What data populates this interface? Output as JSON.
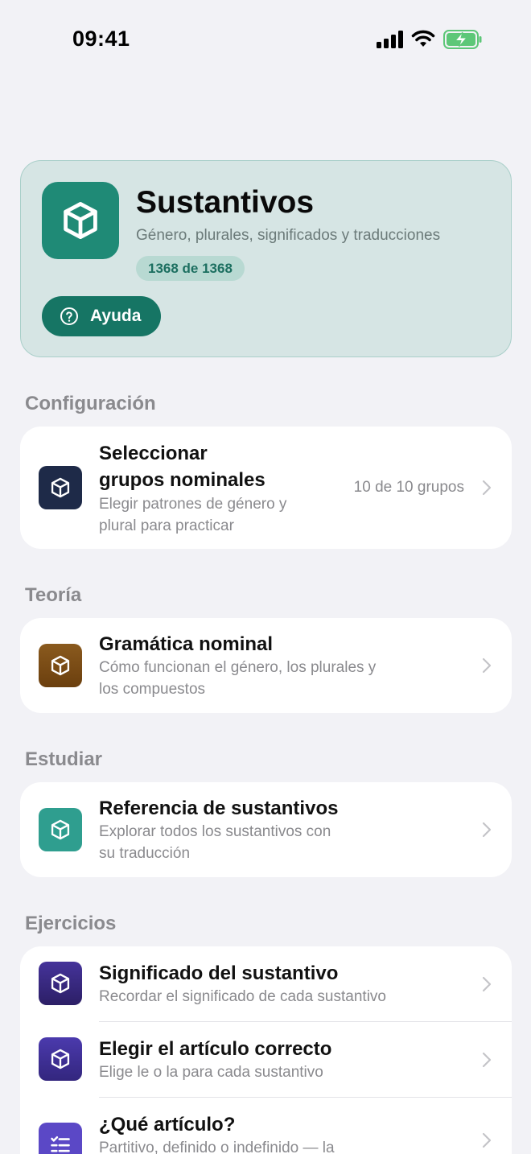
{
  "status_bar": {
    "time": "09:41"
  },
  "hero": {
    "title": "Sustantivos",
    "subtitle": "Género, plurales, significados y traducciones",
    "badge": "1368 de 1368",
    "help_label": "Ayuda",
    "icon": "cube-icon",
    "accent": "#1f8a76"
  },
  "sections": {
    "config": {
      "title": "Configuración",
      "item": {
        "title_line1": "Seleccionar",
        "title_line2": "grupos nominales",
        "desc_line1": "Elegir patrones de género y",
        "desc_line2": "plural para practicar",
        "value": "10 de 10 grupos",
        "icon_color": "#1e2a48"
      }
    },
    "theory": {
      "title": "Teoría",
      "item": {
        "title": "Gramática nominal",
        "desc_line1": "Cómo funcionan el género, los plurales y",
        "desc_line2": "los compuestos",
        "icon_color": "#7a4a14"
      }
    },
    "study": {
      "title": "Estudiar",
      "item": {
        "title": "Referencia de sustantivos",
        "desc_line1": "Explorar todos los sustantivos con",
        "desc_line2": "su traducción",
        "icon_color": "#2f9e8f"
      }
    },
    "exercises": {
      "title": "Ejercicios",
      "items": [
        {
          "title": "Significado del sustantivo",
          "desc": "Recordar el significado de cada sustantivo",
          "icon_color": "#3a2a7a"
        },
        {
          "title": "Elegir el artículo correcto",
          "desc": "Elige le o la para cada sustantivo",
          "icon_color": "#3b2c8e"
        },
        {
          "title": "¿Qué artículo?",
          "desc": "Partitivo, definido o indefinido — la",
          "icon_color": "#5b48c6",
          "icon": "checklist-icon"
        }
      ]
    }
  }
}
